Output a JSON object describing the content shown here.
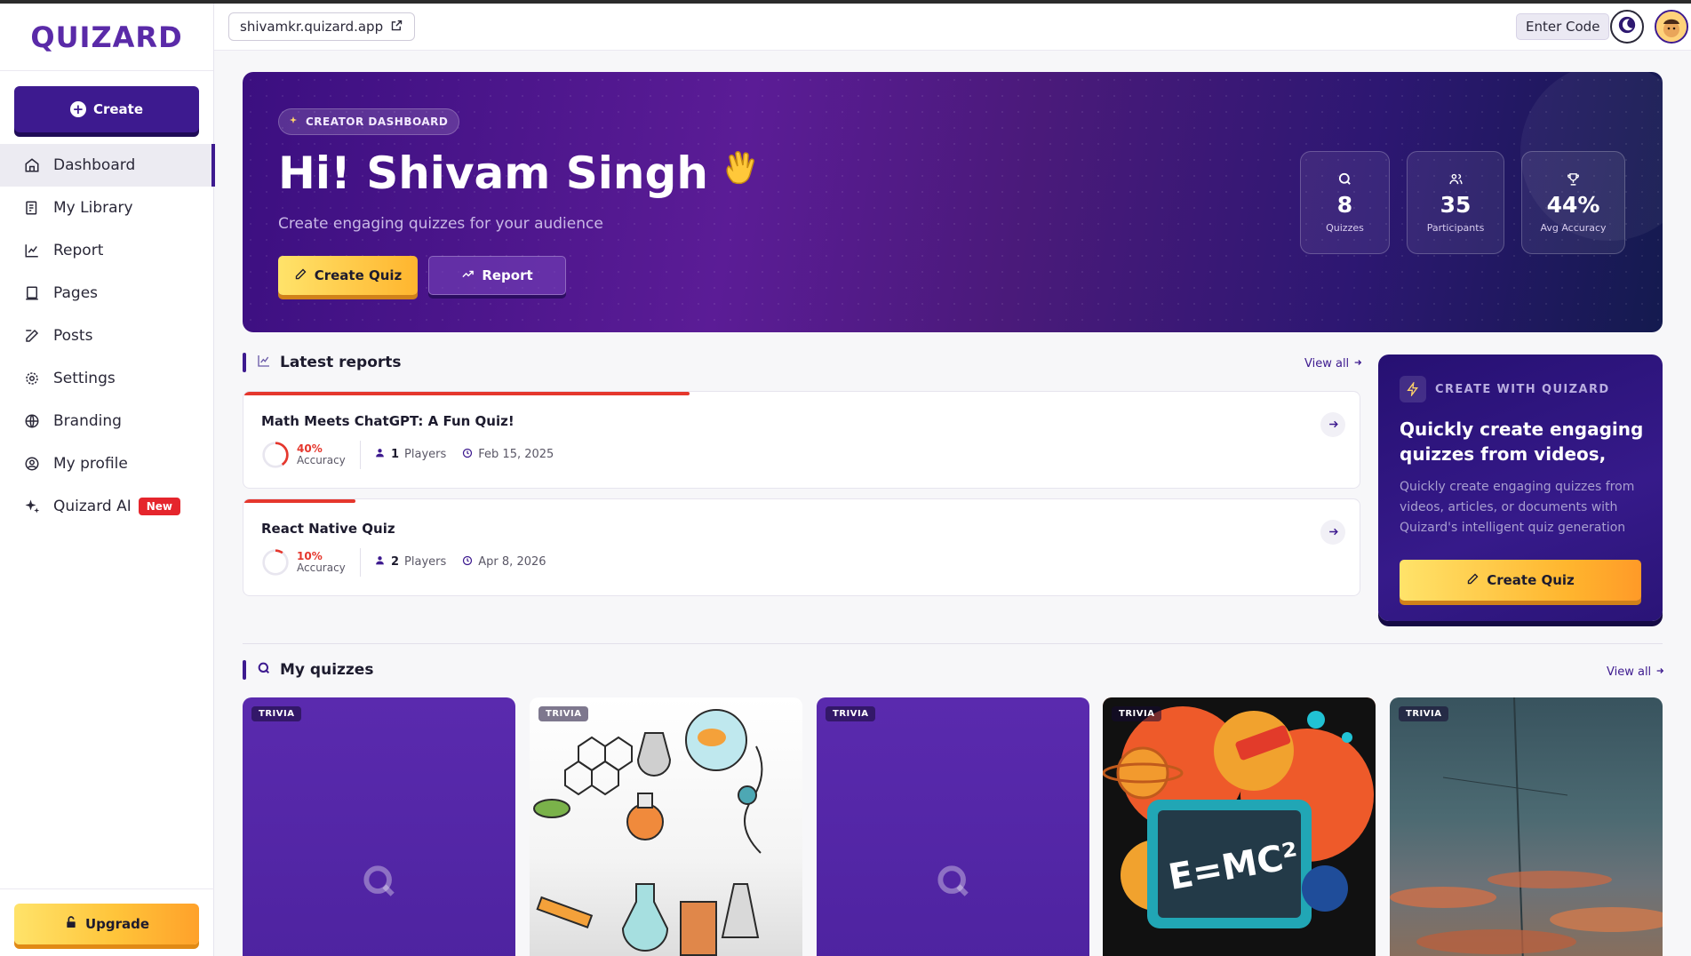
{
  "brand": {
    "logo_text": "QUIZARD"
  },
  "sidebar": {
    "create_label": "Create",
    "items": [
      {
        "label": "Dashboard",
        "icon": "home-icon"
      },
      {
        "label": "My Library",
        "icon": "library-icon"
      },
      {
        "label": "Report",
        "icon": "chart-icon"
      },
      {
        "label": "Pages",
        "icon": "pages-icon"
      },
      {
        "label": "Posts",
        "icon": "edit-icon"
      },
      {
        "label": "Settings",
        "icon": "gear-icon"
      },
      {
        "label": "Branding",
        "icon": "globe-icon"
      },
      {
        "label": "My profile",
        "icon": "user-circle-icon"
      },
      {
        "label": "Quizard AI",
        "icon": "sparkle-icon",
        "badge": "New"
      }
    ],
    "upgrade_label": "Upgrade"
  },
  "topbar": {
    "url": "shivamkr.quizard.app",
    "enter_code": "Enter Code"
  },
  "hero": {
    "badge": "CREATOR DASHBOARD",
    "title": "Hi! Shivam Singh",
    "subtitle": "Create engaging quizzes for your audience",
    "create_btn": "Create Quiz",
    "report_btn": "Report",
    "stats": [
      {
        "value": "8",
        "label": "Quizzes",
        "icon": "quiz-icon"
      },
      {
        "value": "35",
        "label": "Participants",
        "icon": "users-icon"
      },
      {
        "value": "44%",
        "label": "Avg Accuracy",
        "icon": "trophy-icon"
      }
    ]
  },
  "latest_reports": {
    "title": "Latest reports",
    "view_all": "View all",
    "items": [
      {
        "title": "Math Meets ChatGPT: A Fun Quiz!",
        "accuracy": "40%",
        "accuracy_value": 0.4,
        "accuracy_label": "Accuracy",
        "players_count": "1",
        "players_label": "Players",
        "date": "Feb 15, 2025"
      },
      {
        "title": "React Native Quiz",
        "accuracy": "10%",
        "accuracy_value": 0.1,
        "accuracy_label": "Accuracy",
        "players_count": "2",
        "players_label": "Players",
        "date": "Apr 8, 2026"
      }
    ]
  },
  "promo": {
    "badge": "CREATE WITH QUIZARD",
    "title": "Quickly create engaging quizzes from videos,",
    "text": "Quickly create engaging quizzes from videos, articles, or documents with Quizard's intelligent quiz generation",
    "button": "Create Quiz"
  },
  "my_quizzes": {
    "title": "My quizzes",
    "view_all": "View all",
    "tiles": [
      {
        "tag": "TRIVIA",
        "thumb": "quizard-placeholder"
      },
      {
        "tag": "TRIVIA",
        "thumb": "chemistry-illustration"
      },
      {
        "tag": "TRIVIA",
        "thumb": "quizard-placeholder"
      },
      {
        "tag": "TRIVIA",
        "thumb": "physics-illustration",
        "thumb_text": "E=MC²"
      },
      {
        "tag": "TRIVIA",
        "thumb": "sky-photo"
      }
    ]
  },
  "colors": {
    "primary": "#3d1a8f",
    "accent_yellow": "#ffc43a",
    "danger": "#e5372d"
  }
}
